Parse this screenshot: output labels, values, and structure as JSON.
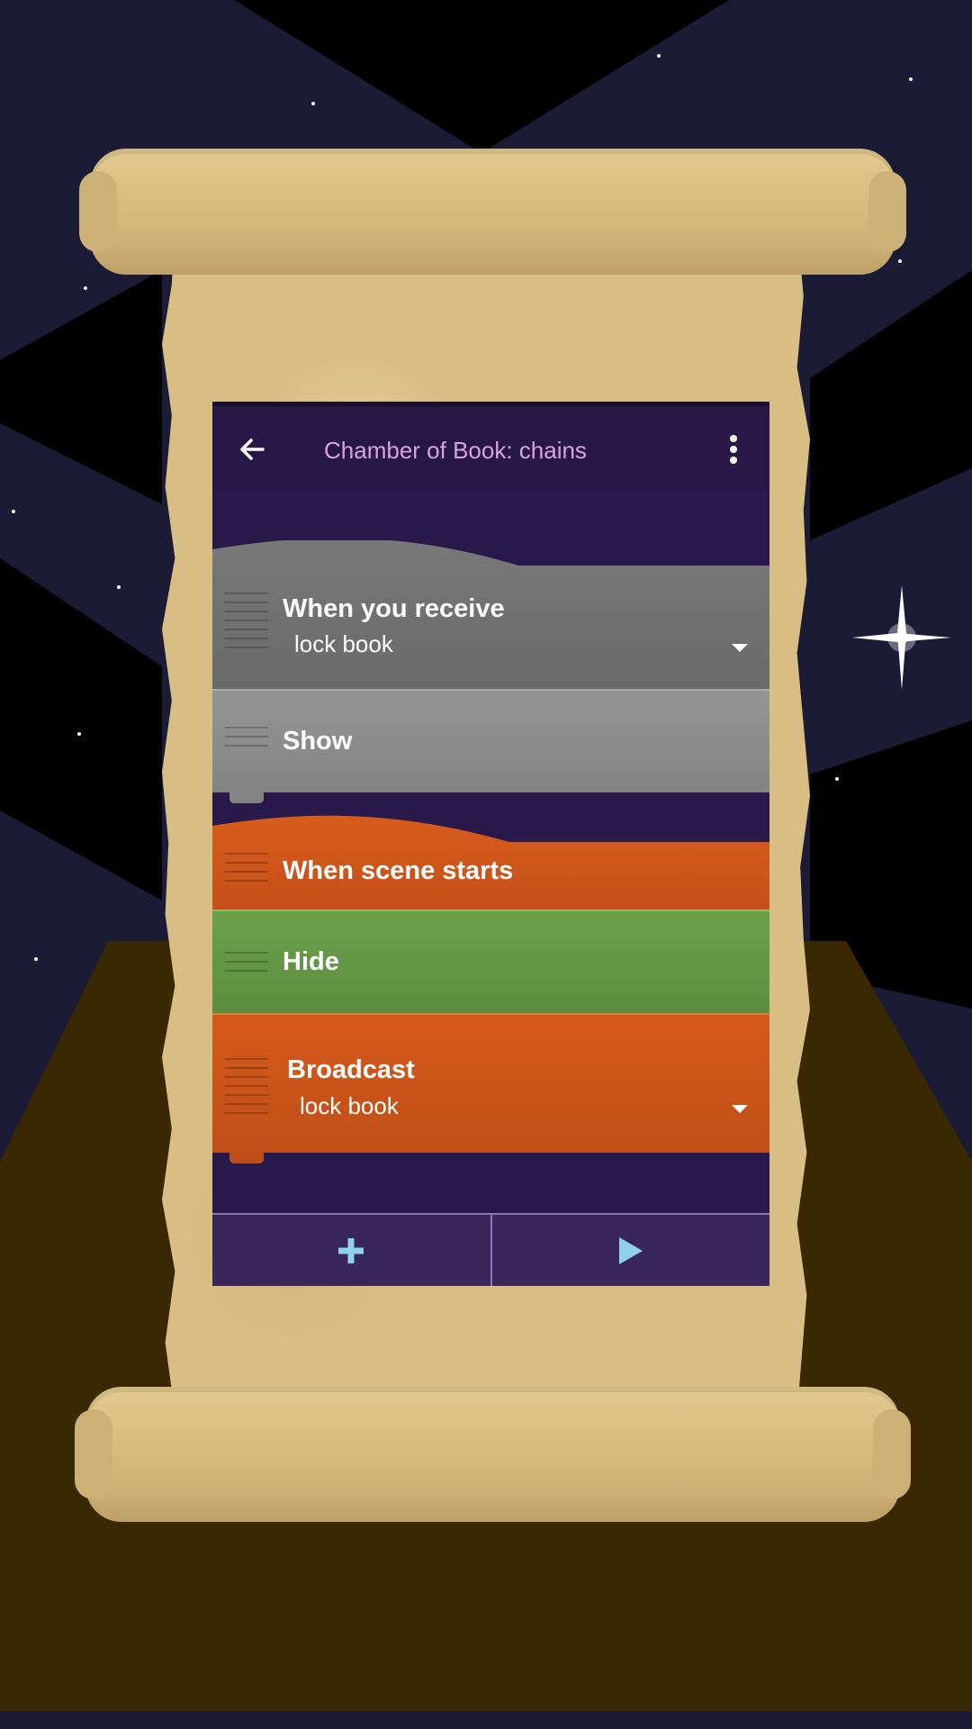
{
  "window": {
    "title": "Chamber of Book: chains"
  },
  "toolbar": {
    "back_icon": "arrow-left-icon",
    "menu_icon": "more-vertical-icon"
  },
  "bricks": [
    {
      "name": "when-you-receive",
      "label": "When you receive",
      "value": "lock book",
      "color": "#6e6e6e",
      "kind": "hat"
    },
    {
      "name": "show",
      "label": "Show",
      "color": "#8e8e8e",
      "kind": "block"
    },
    {
      "name": "when-scene-starts",
      "label": "When scene starts",
      "color": "#d25a1b",
      "kind": "hat"
    },
    {
      "name": "hide",
      "label": "Hide",
      "color": "#689c49",
      "kind": "block"
    },
    {
      "name": "broadcast",
      "label": "Broadcast",
      "value": "lock book",
      "color": "#d25a1b",
      "kind": "block"
    }
  ],
  "bottom_bar": {
    "add_icon": "plus-icon",
    "play_icon": "play-icon"
  },
  "colors": {
    "toolbar_bg": "#281848",
    "script_bg": "#2a1a4b",
    "title_text": "#d7a3e0",
    "bottom_bar_bg": "#39275c",
    "bottom_icon": "#8fd0ec",
    "parchment": "#d8be85",
    "sky": "#1b1b36",
    "ground": "#3a2802"
  }
}
